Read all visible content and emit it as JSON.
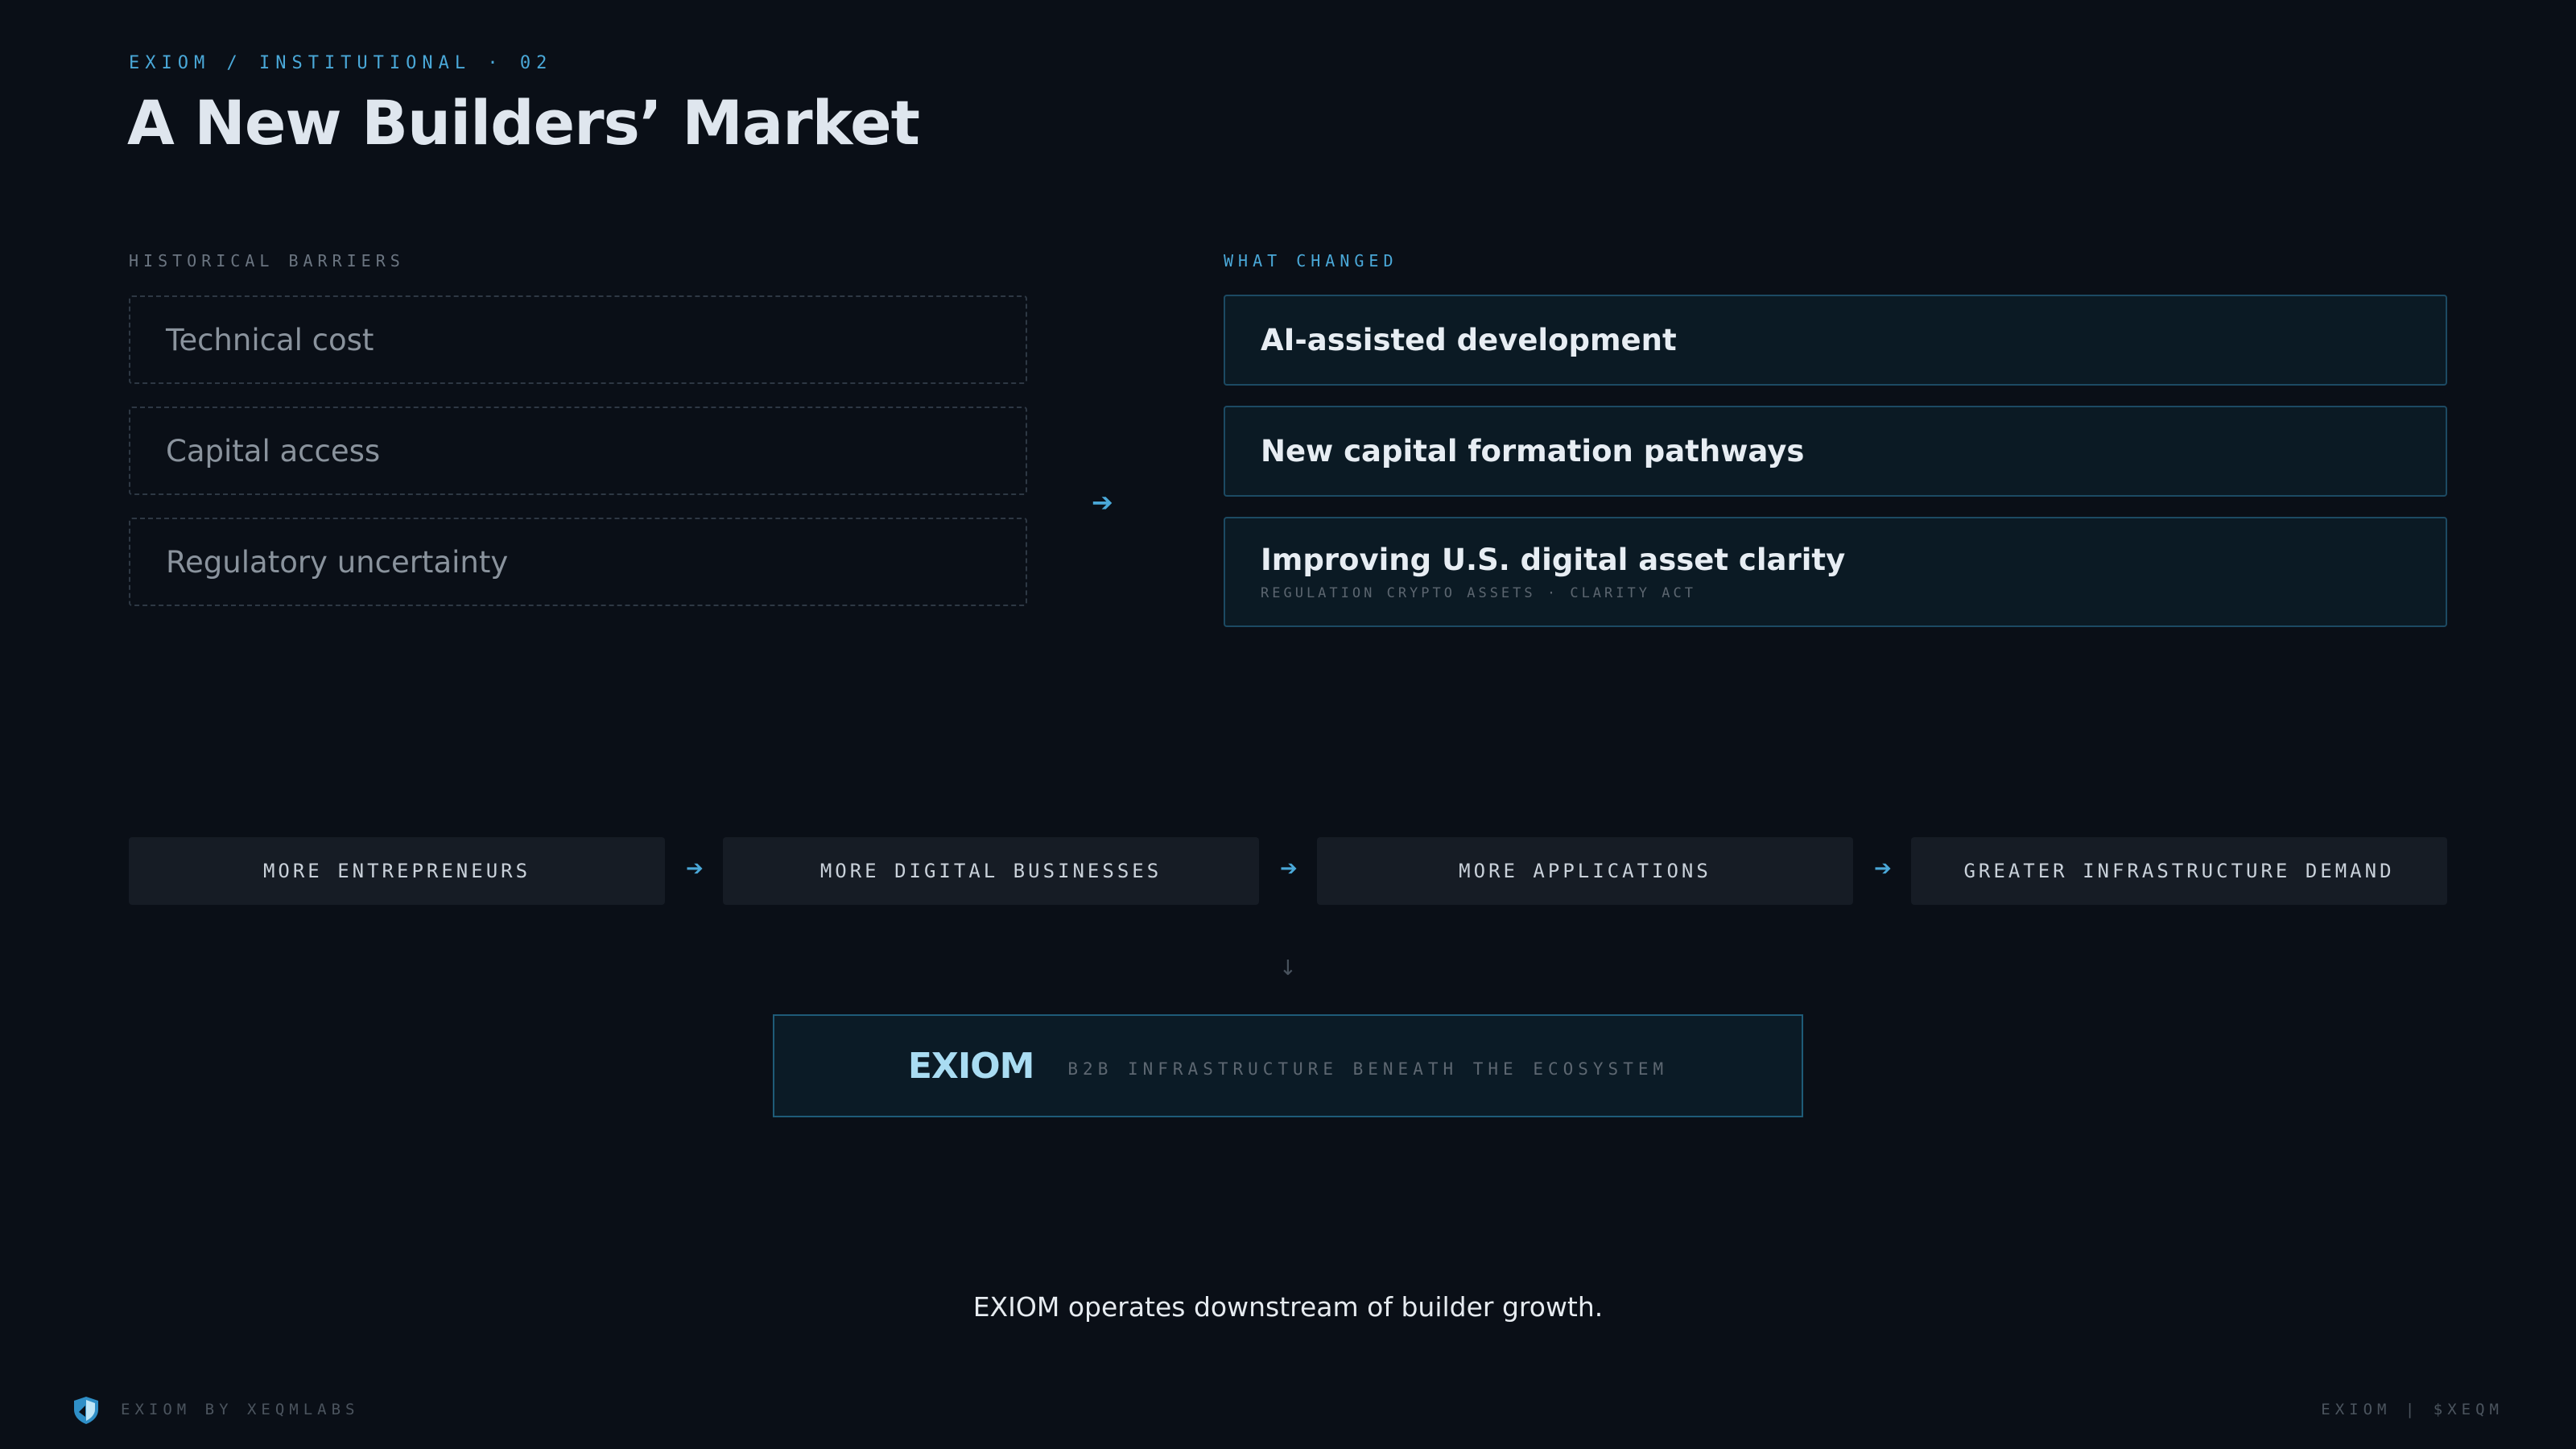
{
  "header": {
    "eyebrow": "EXIOM / INSTITUTIONAL · 02",
    "title": "A New Builders’ Market"
  },
  "barriers": {
    "label": "HISTORICAL BARRIERS",
    "items": [
      "Technical cost",
      "Capital access",
      "Regulatory uncertainty"
    ]
  },
  "transition_arrow": "➔",
  "changes": {
    "label": "WHAT CHANGED",
    "items": [
      {
        "title": "AI-assisted development"
      },
      {
        "title": "New capital formation pathways"
      },
      {
        "title": "Improving U.S. digital asset clarity",
        "subtitle": "REGULATION CRYPTO ASSETS · CLARITY ACT"
      }
    ]
  },
  "flow": {
    "steps": [
      "MORE ENTREPRENEURS",
      "MORE DIGITAL BUSINESSES",
      "MORE APPLICATIONS",
      "GREATER INFRASTRUCTURE DEMAND"
    ],
    "arrow": "➔",
    "down_arrow": "↓"
  },
  "exiom": {
    "name": "EXIOM",
    "tagline": "B2B INFRASTRUCTURE BENEATH THE ECOSYSTEM"
  },
  "caption": "EXIOM operates downstream of builder growth.",
  "footer": {
    "left": "EXIOM BY XEQMLABS",
    "right": "EXIOM | $XEQM",
    "logo_icon": "shield-icon"
  },
  "colors": {
    "background": "#0a0f17",
    "accent": "#4aa8d8",
    "card_border": "#1c4a63"
  }
}
